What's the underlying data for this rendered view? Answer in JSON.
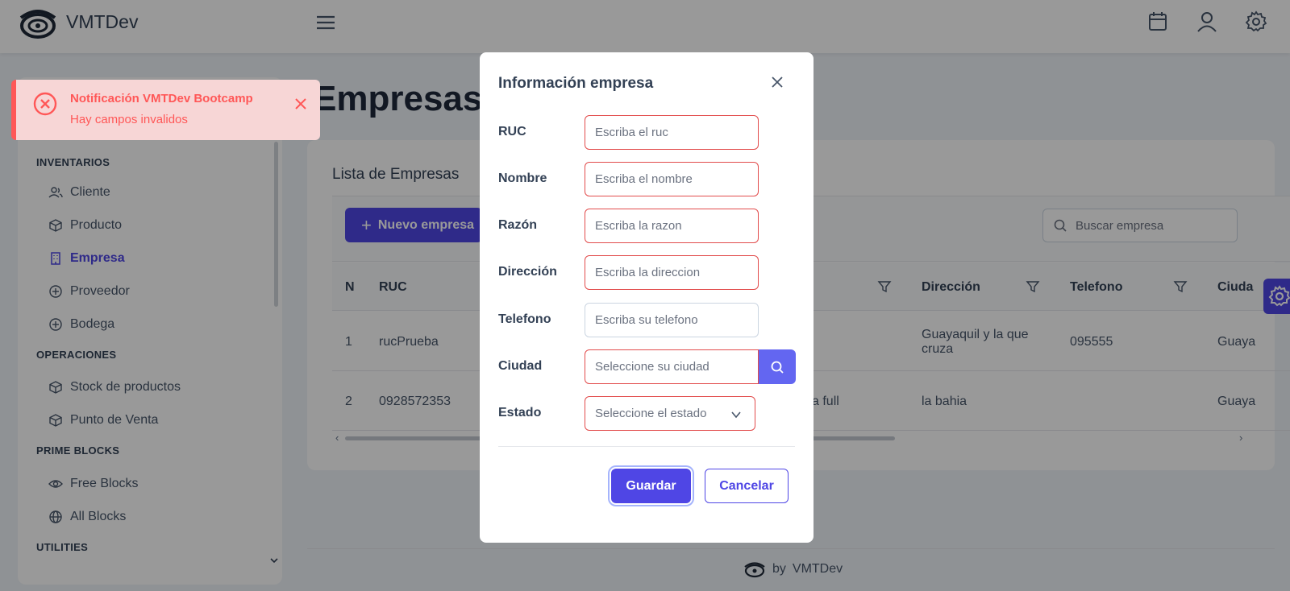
{
  "app": {
    "brand": "VMTDev"
  },
  "colors": {
    "accent": "#4f46e5",
    "error": "#ff5757",
    "button_secondary_icon": "#6366f1"
  },
  "topbar": {
    "icons": [
      "menu-icon",
      "calendar-icon",
      "user-icon",
      "settings-icon"
    ]
  },
  "sidebar": {
    "sections": [
      {
        "title": "INVENTARIOS",
        "items": [
          {
            "label": "Cliente",
            "icon": "users-icon"
          },
          {
            "label": "Producto",
            "icon": "box-icon"
          },
          {
            "label": "Empresa",
            "icon": "building-icon",
            "active": true
          },
          {
            "label": "Proveedor",
            "icon": "plus-circle-icon"
          },
          {
            "label": "Bodega",
            "icon": "plus-circle-icon"
          }
        ]
      },
      {
        "title": "OPERACIONES",
        "items": [
          {
            "label": "Stock de productos",
            "icon": "box-icon"
          },
          {
            "label": "Punto de Venta",
            "icon": "box-icon"
          }
        ]
      },
      {
        "title": "PRIME BLOCKS",
        "items": [
          {
            "label": "Free Blocks",
            "icon": "eye-icon"
          },
          {
            "label": "All Blocks",
            "icon": "globe-icon"
          }
        ]
      },
      {
        "title": "UTILITIES",
        "items": []
      }
    ]
  },
  "main": {
    "page_title": "Empresas",
    "card_title": "Lista de Empresas",
    "new_button": "Nuevo empresa",
    "search_placeholder": "Buscar empresa",
    "table": {
      "columns": [
        "N",
        "RUC",
        "Dirección",
        "Telefono",
        "Ciuda"
      ],
      "rows": [
        {
          "n": "1",
          "ruc": "rucPrueba",
          "direccion": "Guayaquil y la que cruza",
          "telefono": "095555",
          "ciudad": "Guaya"
        },
        {
          "n": "2",
          "ruc": "0928572353",
          "hidden": "a full",
          "direccion": "la bahia",
          "telefono": "",
          "ciudad": "Guaya"
        }
      ]
    }
  },
  "footer": {
    "by": "by",
    "brand": "VMTDev"
  },
  "toast": {
    "title": "Notificación VMTDev Bootcamp",
    "message": "Hay campos invalidos"
  },
  "dialog": {
    "title": "Información empresa",
    "fields": {
      "ruc": {
        "label": "RUC",
        "placeholder": "Escriba el ruc"
      },
      "nombre": {
        "label": "Nombre",
        "placeholder": "Escriba el nombre"
      },
      "razon": {
        "label": "Razón",
        "placeholder": "Escriba la razon"
      },
      "direccion": {
        "label": "Dirección",
        "placeholder": "Escriba la direccion"
      },
      "telefono": {
        "label": "Telefono",
        "placeholder": "Escriba su telefono"
      },
      "ciudad": {
        "label": "Ciudad",
        "placeholder": "Seleccione su ciudad"
      },
      "estado": {
        "label": "Estado",
        "placeholder": "Seleccione el estado"
      }
    },
    "save": "Guardar",
    "cancel": "Cancelar"
  }
}
